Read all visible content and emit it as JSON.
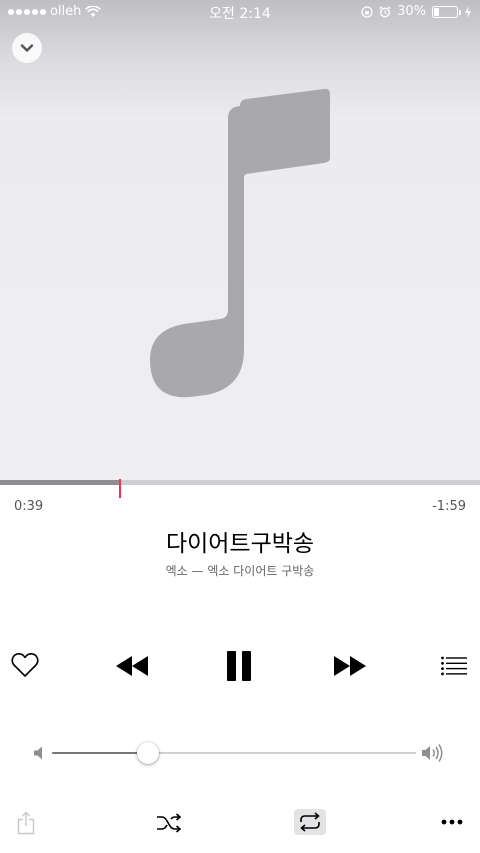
{
  "status_bar": {
    "carrier": "olleh",
    "time": "오전 2:14",
    "battery_percent": "30%",
    "battery_level": 0.3
  },
  "artwork": {
    "placeholder_icon": "music-note-icon",
    "collapse_icon": "chevron-down-icon"
  },
  "playback": {
    "elapsed": "0:39",
    "remaining": "-1:59",
    "progress_fraction": 0.25
  },
  "track": {
    "title": "다이어트구박송",
    "subtitle": "엑소 — 엑소 다이어트 구박송"
  },
  "controls": {
    "love_icon": "heart-icon",
    "previous_icon": "rewind-icon",
    "play_state_icon": "pause-icon",
    "next_icon": "fast-forward-icon",
    "queue_icon": "list-icon"
  },
  "volume": {
    "level_fraction": 0.265,
    "low_icon": "speaker-low-icon",
    "high_icon": "speaker-high-icon"
  },
  "bottom_bar": {
    "share_icon": "share-icon",
    "shuffle_icon": "shuffle-icon",
    "repeat_icon": "repeat-icon",
    "repeat_active": true,
    "more_icon": "more-icon"
  },
  "colors": {
    "accent": "#ff2d55",
    "artwork_bg": "#efeff2",
    "note": "#a9a9ad"
  }
}
